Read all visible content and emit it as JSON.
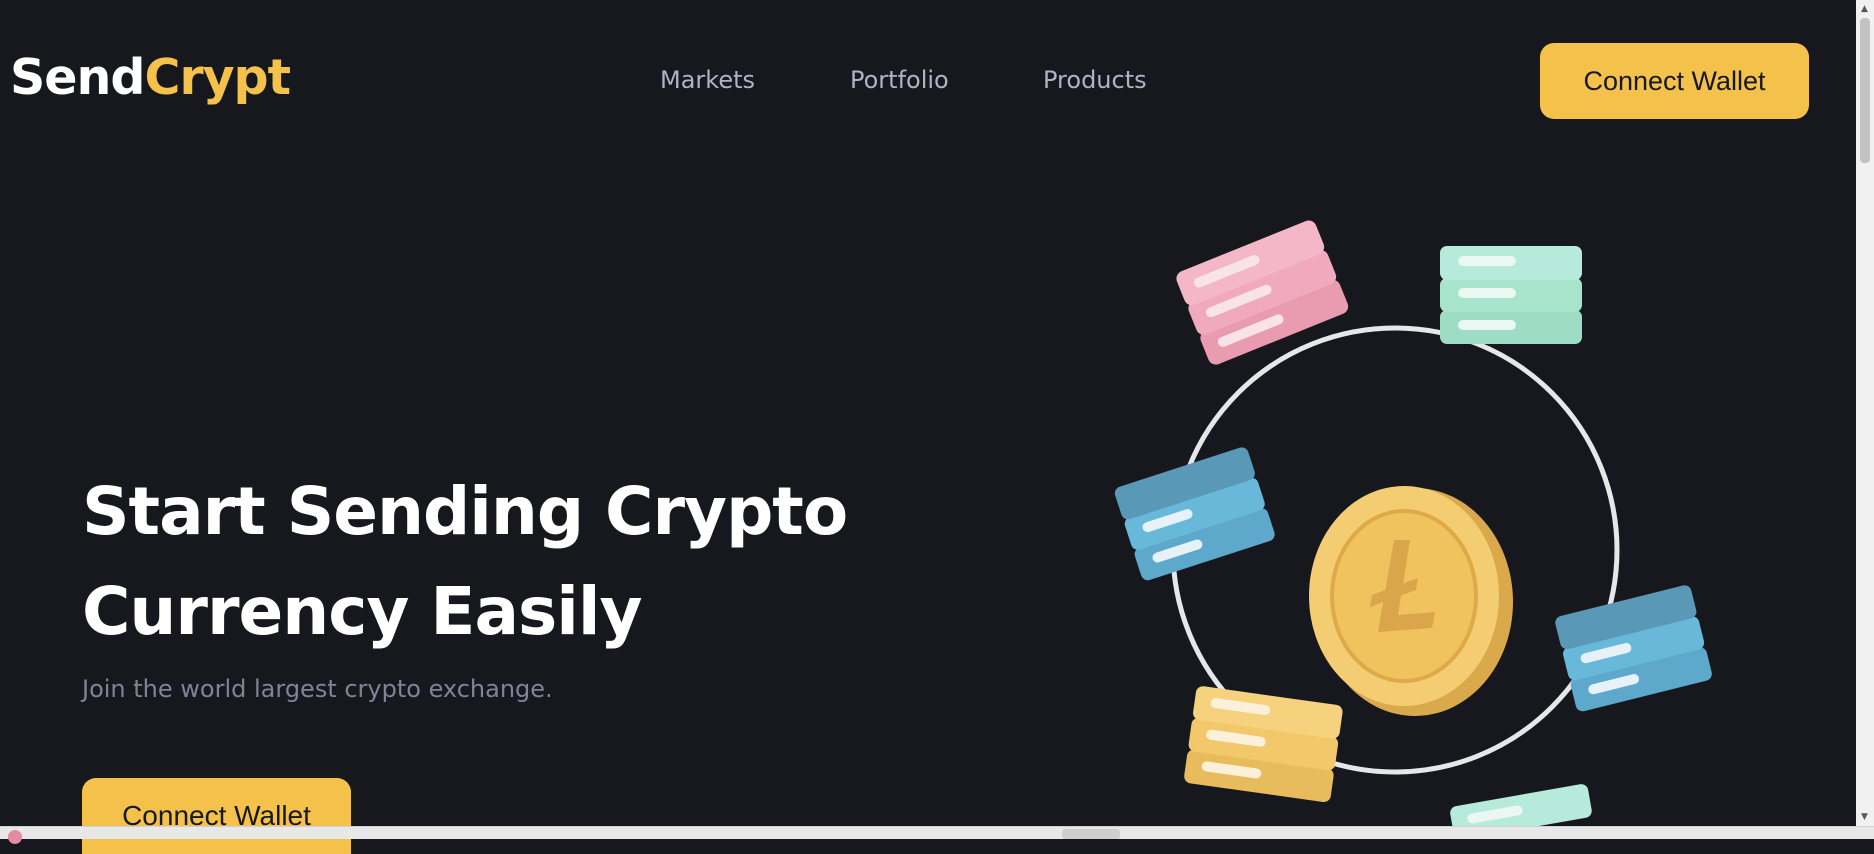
{
  "brand": {
    "part1": "Send",
    "part2": "Crypt",
    "color_accent": "#f4c24a"
  },
  "nav": {
    "items": [
      {
        "label": "Markets"
      },
      {
        "label": "Portfolio"
      },
      {
        "label": "Products"
      }
    ],
    "cta_label": "Connect Wallet"
  },
  "hero": {
    "title_line1": "Start Sending Crypto",
    "title_line2": "Currency Easily",
    "subtitle": "Join the world largest crypto exchange.",
    "cta_label": "Connect Wallet"
  },
  "illustration": {
    "icon": "litecoin-network-icon",
    "colors": {
      "pink": "#f0a9bd",
      "mint": "#a8e3cc",
      "blue": "#68b8da",
      "gold": "#f3c86a"
    }
  },
  "theme": {
    "background": "#17181d",
    "text_muted": "#7f8398",
    "nav_text": "#aeb3c6"
  }
}
